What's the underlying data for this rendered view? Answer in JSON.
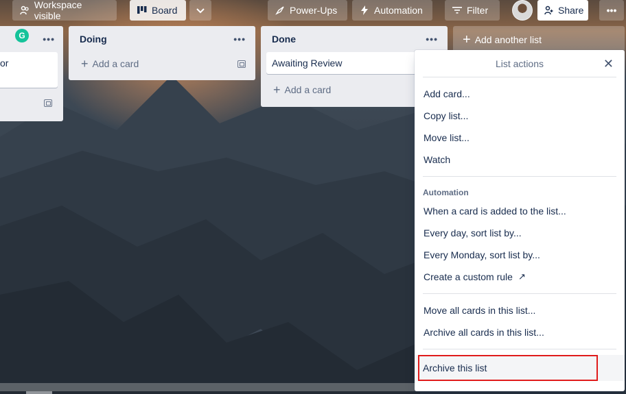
{
  "header": {
    "visibility_label": "Workspace visible",
    "board_label": "Board",
    "powerups_label": "Power-Ups",
    "automation_label": "Automation",
    "filter_label": "Filter",
    "share_label": "Share",
    "more_label": "•••"
  },
  "lists": [
    {
      "title": "",
      "card_text": "or",
      "add_card_label": ""
    },
    {
      "title": "Doing",
      "add_card_label": "Add a card"
    },
    {
      "title": "Done",
      "card_text": "Awaiting Review",
      "add_card_label": "Add a card"
    }
  ],
  "add_list_label": "Add another list",
  "popover": {
    "title": "List actions",
    "items_main": [
      "Add card...",
      "Copy list...",
      "Move list...",
      "Watch"
    ],
    "automation_heading": "Automation",
    "items_automation": [
      "When a card is added to the list...",
      "Every day, sort list by...",
      "Every Monday, sort list by...",
      "Create a custom rule"
    ],
    "items_bulk": [
      "Move all cards in this list...",
      "Archive all cards in this list..."
    ],
    "archive_list_label": "Archive this list"
  },
  "colors": {
    "highlight_border": "#e01b1b",
    "grammarly": "#15c39a",
    "list_bg": "#ebecf0"
  },
  "icons": {
    "grammarly": "G"
  }
}
